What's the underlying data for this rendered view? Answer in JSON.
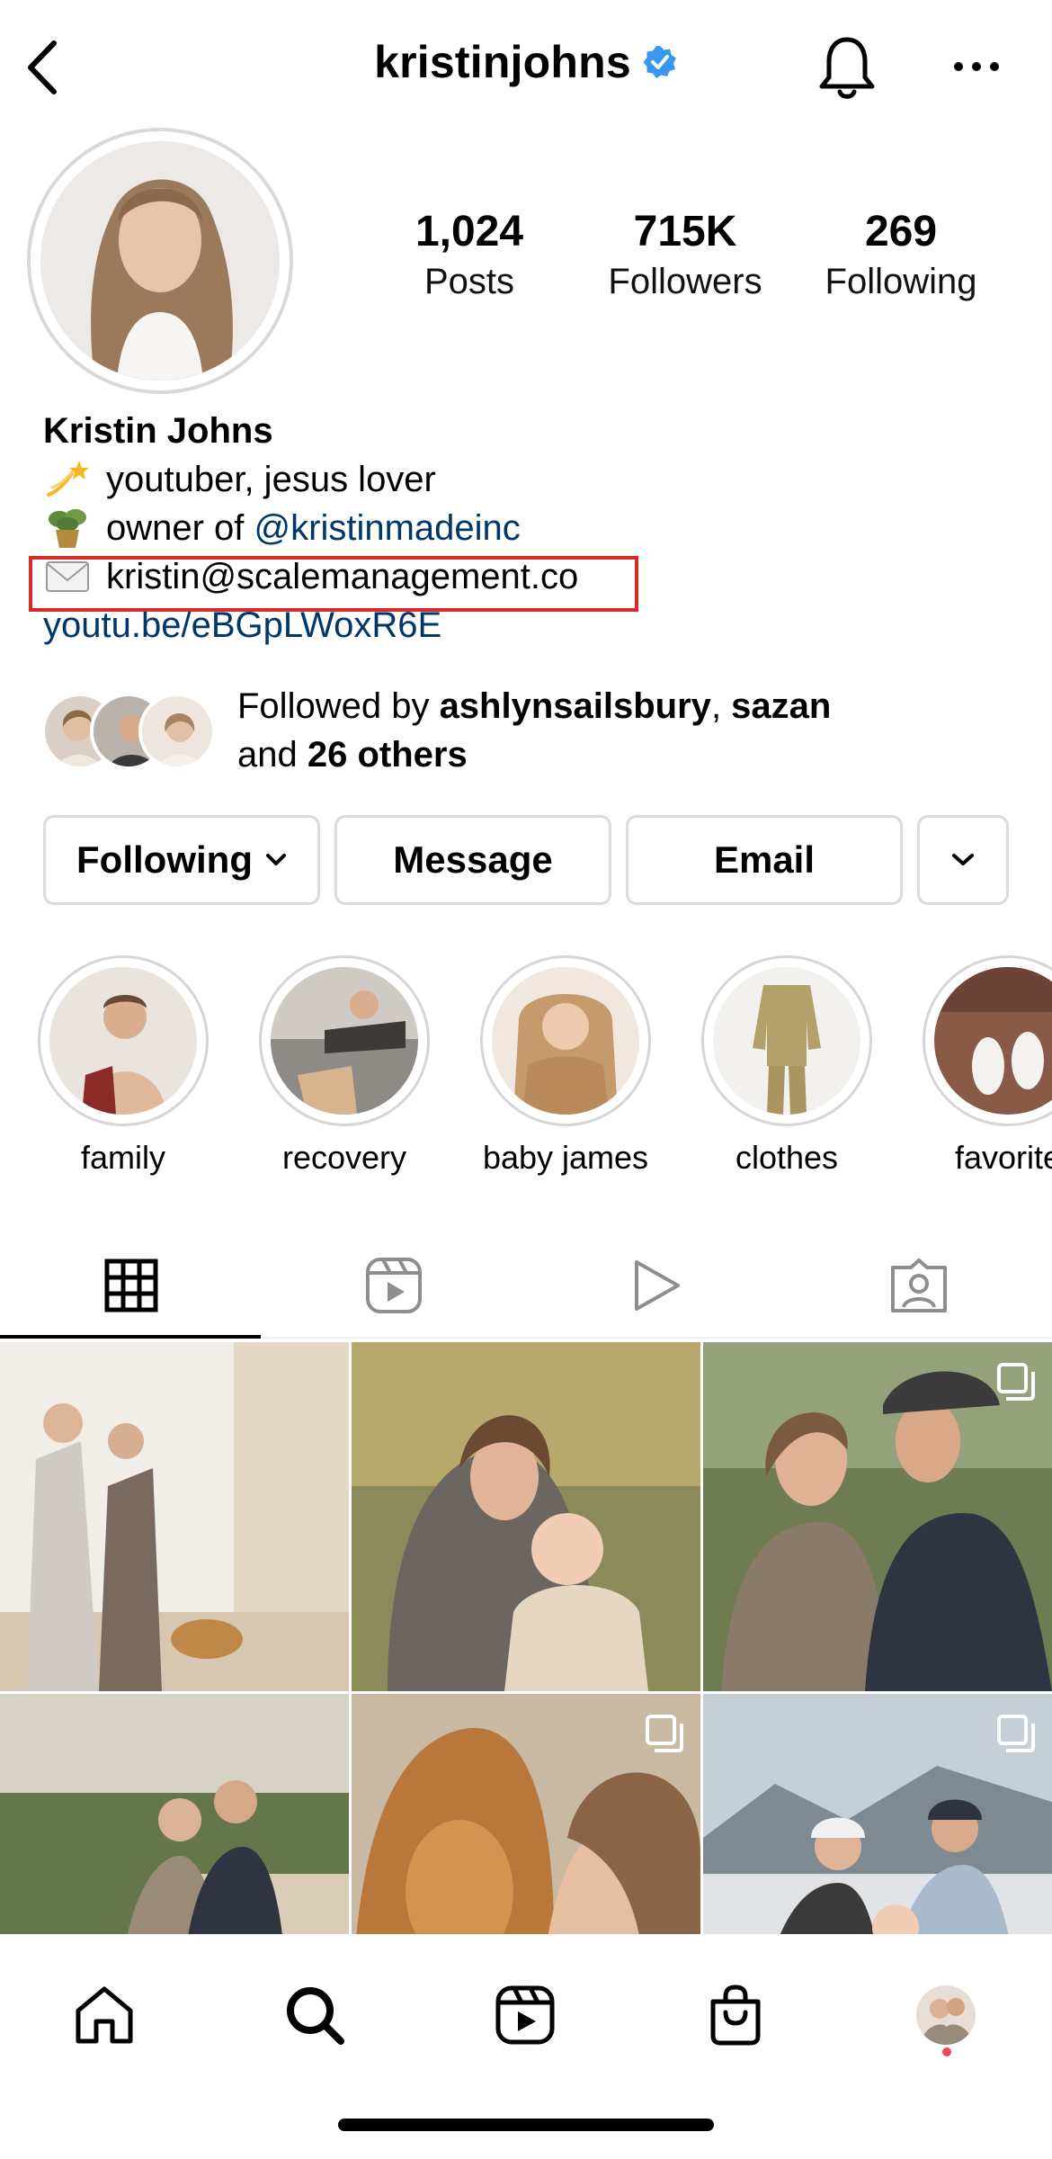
{
  "header": {
    "username": "kristinjohns",
    "verified": true
  },
  "stats": [
    {
      "value": "1,024",
      "label": "Posts"
    },
    {
      "value": "715K",
      "label": "Followers"
    },
    {
      "value": "269",
      "label": "Following"
    }
  ],
  "bio": {
    "name": "Kristin Johns",
    "line1": "youtuber, jesus lover",
    "line2_prefix": "owner of ",
    "line2_mention": "@kristinmadeinc",
    "email": "kristin@scalemanagement.co",
    "link": "youtu.be/eBGpLWoxR6E"
  },
  "followed_by": {
    "prefix": "Followed by ",
    "user1": "ashlynsailsbury",
    "sep": ", ",
    "user2": "sazan",
    "and": "and ",
    "others": "26 others"
  },
  "buttons": {
    "following": "Following",
    "message": "Message",
    "email": "Email"
  },
  "highlights": [
    {
      "label": "family"
    },
    {
      "label": "recovery"
    },
    {
      "label": "baby james"
    },
    {
      "label": "clothes"
    },
    {
      "label": "favorite"
    }
  ],
  "tabs": [
    "grid-icon",
    "reels-icon",
    "video-icon",
    "tagged-icon"
  ],
  "nav": [
    "home-icon",
    "search-icon",
    "reels-icon",
    "shop-icon",
    "profile-avatar"
  ],
  "colors": {
    "link": "#00376b",
    "verified": "#3897f0",
    "highlight_box": "#d62b2b",
    "notification_dot": "#ed4956"
  }
}
